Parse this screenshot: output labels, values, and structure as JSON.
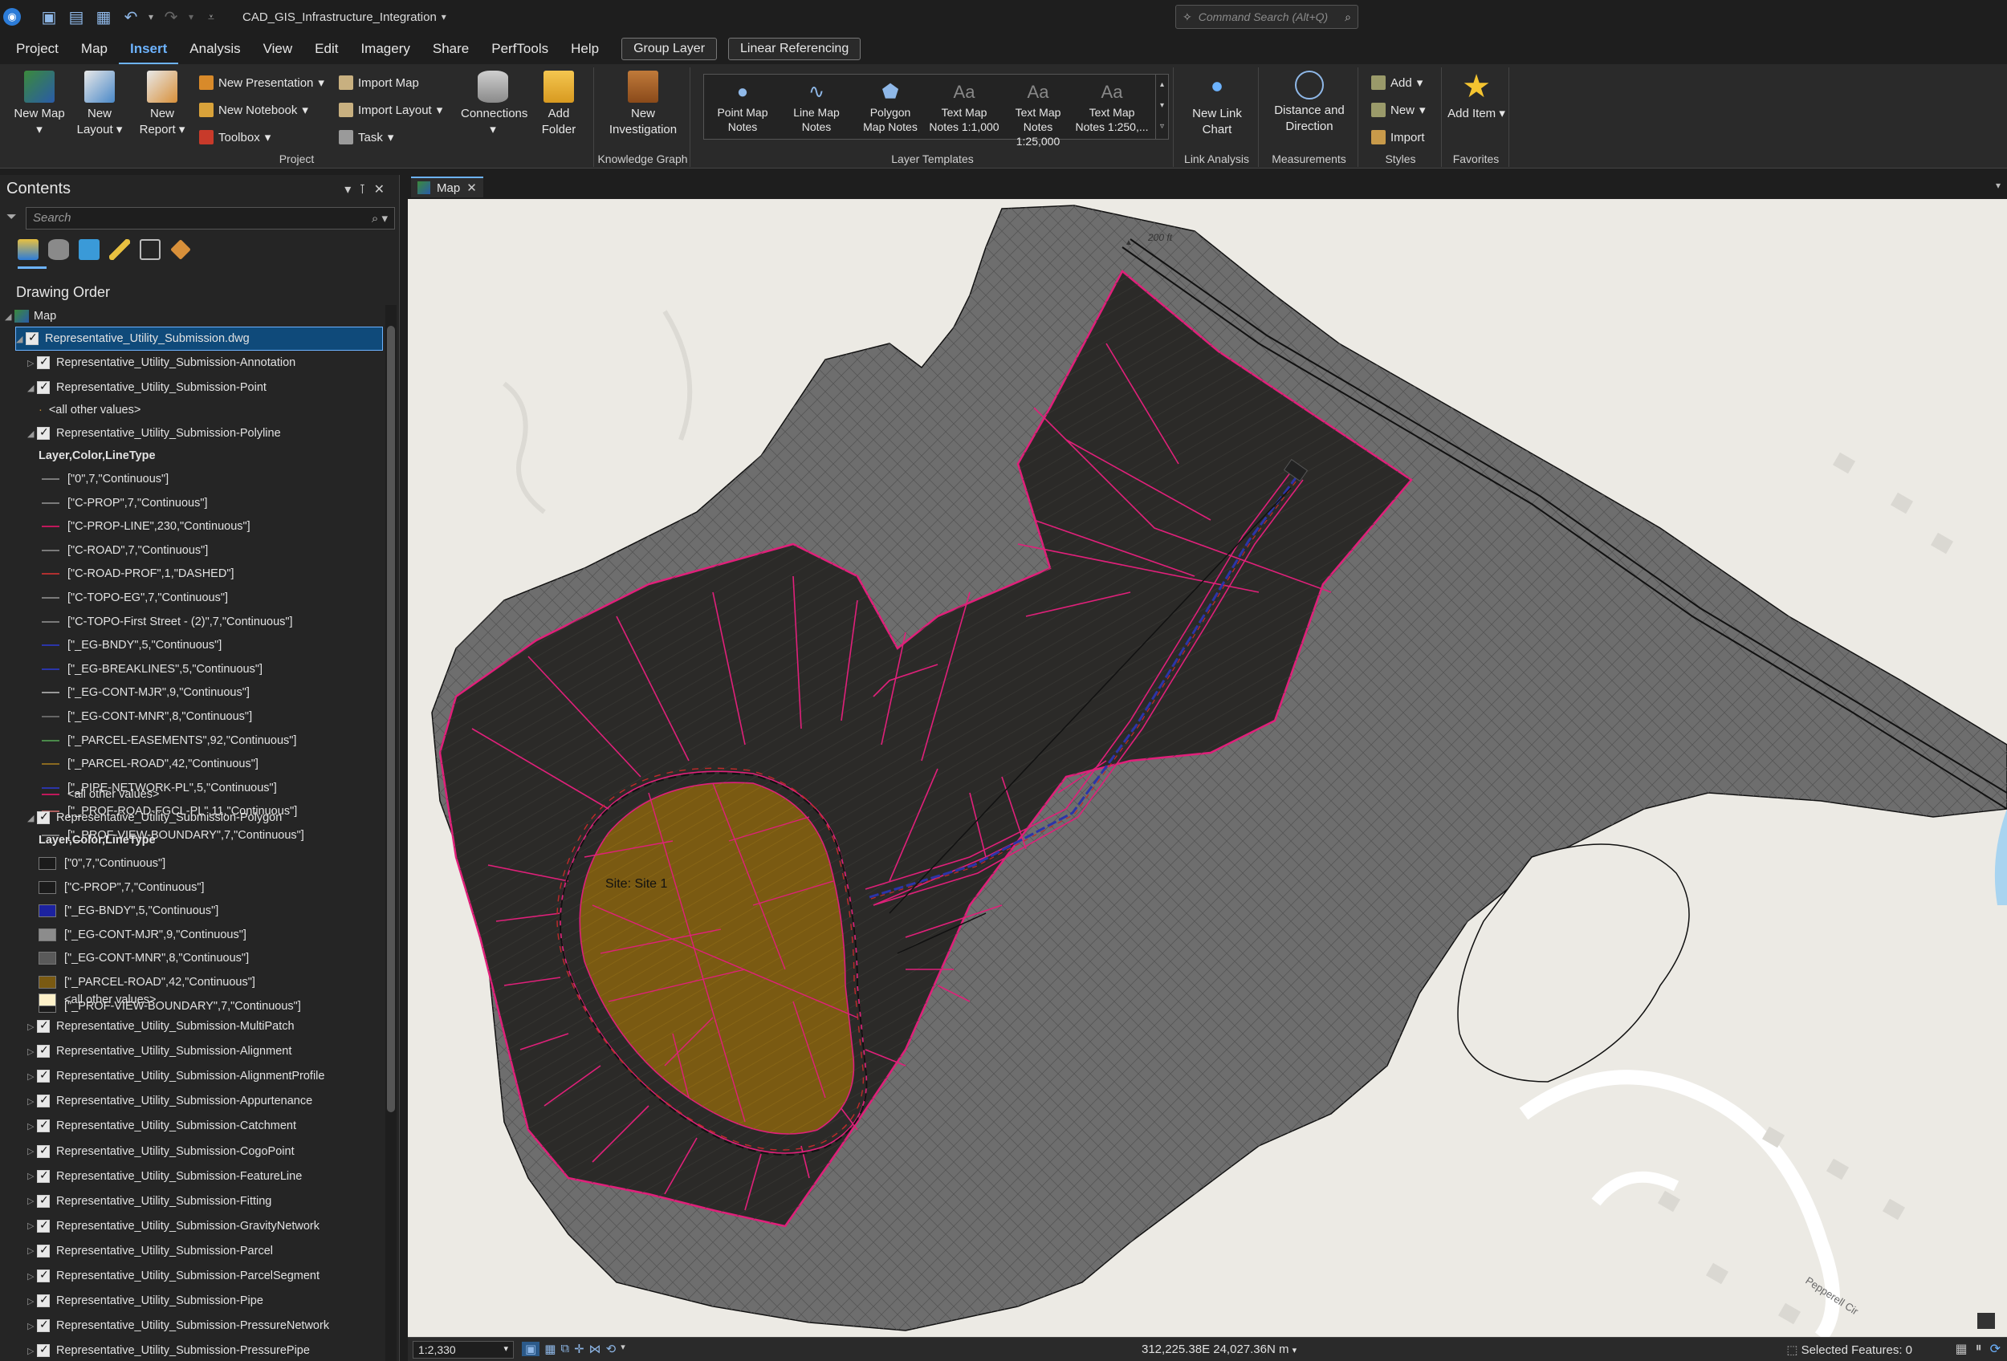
{
  "title_bar": {
    "document_title": "CAD_GIS_Infrastructure_Integration",
    "command_search_placeholder": "Command Search (Alt+Q)"
  },
  "ribbon_tabs": [
    "Project",
    "Map",
    "Insert",
    "Analysis",
    "View",
    "Edit",
    "Imagery",
    "Share",
    "PerfTools",
    "Help"
  ],
  "active_tab": "Insert",
  "contextual_tabs": [
    "Group Layer",
    "Linear Referencing"
  ],
  "ribbon": {
    "project": {
      "group_label": "Project",
      "new_map": "New Map",
      "new_layout": "New Layout",
      "new_report": "New Report",
      "new_presentation": "New Presentation",
      "new_notebook": "New Notebook",
      "toolbox": "Toolbox",
      "import_map": "Import Map",
      "import_layout": "Import Layout",
      "task": "Task",
      "connections": "Connections",
      "add_folder": "Add Folder"
    },
    "knowledge_graph": {
      "group_label": "Knowledge Graph",
      "new_investigation": "New Investigation"
    },
    "layer_templates": {
      "group_label": "Layer Templates",
      "items": [
        {
          "line1": "Point Map",
          "line2": "Notes"
        },
        {
          "line1": "Line Map",
          "line2": "Notes"
        },
        {
          "line1": "Polygon",
          "line2": "Map Notes"
        },
        {
          "line1": "Text Map",
          "line2": "Notes 1:1,000"
        },
        {
          "line1": "Text Map",
          "line2": "Notes 1:25,000"
        },
        {
          "line1": "Text Map",
          "line2": "Notes 1:250,..."
        }
      ]
    },
    "link_analysis": {
      "group_label": "Link Analysis",
      "new_link_chart": "New Link Chart"
    },
    "measurements": {
      "group_label": "Measurements",
      "distance_direction": "Distance and Direction"
    },
    "styles": {
      "group_label": "Styles",
      "add": "Add",
      "new": "New",
      "import": "Import"
    },
    "favorites": {
      "group_label": "Favorites",
      "add_item": "Add Item"
    }
  },
  "contents": {
    "title": "Contents",
    "search_placeholder": "Search",
    "drawing_order": "Drawing Order",
    "map_name": "Map",
    "dwg_layer": "Representative_Utility_Submission.dwg",
    "annotation": "Representative_Utility_Submission-Annotation",
    "point": "Representative_Utility_Submission-Point",
    "point_other": "<all other values>",
    "polyline": "Representative_Utility_Submission-Polyline",
    "field_header": "Layer,Color,LineType",
    "polyline_classes": [
      {
        "label": "[\"0\",7,\"Continuous\"]",
        "color": "#7a7a7a"
      },
      {
        "label": "[\"C-PROP\",7,\"Continuous\"]",
        "color": "#7a7a7a"
      },
      {
        "label": "[\"C-PROP-LINE\",230,\"Continuous\"]",
        "color": "#c0185b"
      },
      {
        "label": "[\"C-ROAD\",7,\"Continuous\"]",
        "color": "#7a7a7a"
      },
      {
        "label": "[\"C-ROAD-PROF\",1,\"DASHED\"]",
        "color": "#b03030"
      },
      {
        "label": "[\"C-TOPO-EG\",7,\"Continuous\"]",
        "color": "#7a7a7a"
      },
      {
        "label": "[\"C-TOPO-First Street - (2)\",7,\"Continuous\"]",
        "color": "#7a7a7a"
      },
      {
        "label": "[\"_EG-BNDY\",5,\"Continuous\"]",
        "color": "#2b35a8"
      },
      {
        "label": "[\"_EG-BREAKLINES\",5,\"Continuous\"]",
        "color": "#2b35a8"
      },
      {
        "label": "[\"_EG-CONT-MJR\",9,\"Continuous\"]",
        "color": "#999999"
      },
      {
        "label": "[\"_EG-CONT-MNR\",8,\"Continuous\"]",
        "color": "#666666"
      },
      {
        "label": "[\"_PARCEL-EASEMENTS\",92,\"Continuous\"]",
        "color": "#4a8a4a"
      },
      {
        "label": "[\"_PARCEL-ROAD\",42,\"Continuous\"]",
        "color": "#8a6a20"
      },
      {
        "label": "[\"_PIPE-NETWORK-PL\",5,\"Continuous\"]",
        "color": "#2b35a8"
      },
      {
        "label": "[\"_PROF-ROAD-FGCL-PL\",11,\"Continuous\"]",
        "color": "#b06060"
      },
      {
        "label": "[\"_PROF-VIEW-BOUNDARY\",7,\"Continuous\"]",
        "color": "#7a7a7a"
      }
    ],
    "polyline_other": "<all other values>",
    "polygon": "Representative_Utility_Submission-Polygon",
    "polygon_classes": [
      {
        "label": "[\"0\",7,\"Continuous\"]",
        "color": "#1b1b1b"
      },
      {
        "label": "[\"C-PROP\",7,\"Continuous\"]",
        "color": "#1b1b1b"
      },
      {
        "label": "[\"_EG-BNDY\",5,\"Continuous\"]",
        "color": "#1c22a0"
      },
      {
        "label": "[\"_EG-CONT-MJR\",9,\"Continuous\"]",
        "color": "#8c8c8c"
      },
      {
        "label": "[\"_EG-CONT-MNR\",8,\"Continuous\"]",
        "color": "#5a5a5a"
      },
      {
        "label": "[\"_PARCEL-ROAD\",42,\"Continuous\"]",
        "color": "#7a5a12"
      },
      {
        "label": "[\"_PROF-VIEW-BOUNDARY\",7,\"Continuous\"]",
        "color": "#1b1b1b"
      }
    ],
    "polygon_other": "<all other values>",
    "other_layers": [
      "Representative_Utility_Submission-MultiPatch",
      "Representative_Utility_Submission-Alignment",
      "Representative_Utility_Submission-AlignmentProfile",
      "Representative_Utility_Submission-Appurtenance",
      "Representative_Utility_Submission-Catchment",
      "Representative_Utility_Submission-CogoPoint",
      "Representative_Utility_Submission-FeatureLine",
      "Representative_Utility_Submission-Fitting",
      "Representative_Utility_Submission-GravityNetwork",
      "Representative_Utility_Submission-Parcel",
      "Representative_Utility_Submission-ParcelSegment",
      "Representative_Utility_Submission-Pipe",
      "Representative_Utility_Submission-PressureNetwork",
      "Representative_Utility_Submission-PressurePipe"
    ]
  },
  "map_view": {
    "tab_label": "Map",
    "scale_label": "200 ft",
    "site_label": "Site: Site 1",
    "street_label": "Pepperell Cir"
  },
  "status_bar": {
    "scale": "1:2,330",
    "coordinates": "312,225.38E 24,027.36N m",
    "selected_features": "Selected Features: 0"
  },
  "colors": {
    "accent": "#6db3ff",
    "parcel_line": "#e0207a",
    "road_fill": "#7a5a12",
    "site_fill": "#2b2a28",
    "terrain": "#6e6e6e",
    "basemap": "#eceae4"
  }
}
